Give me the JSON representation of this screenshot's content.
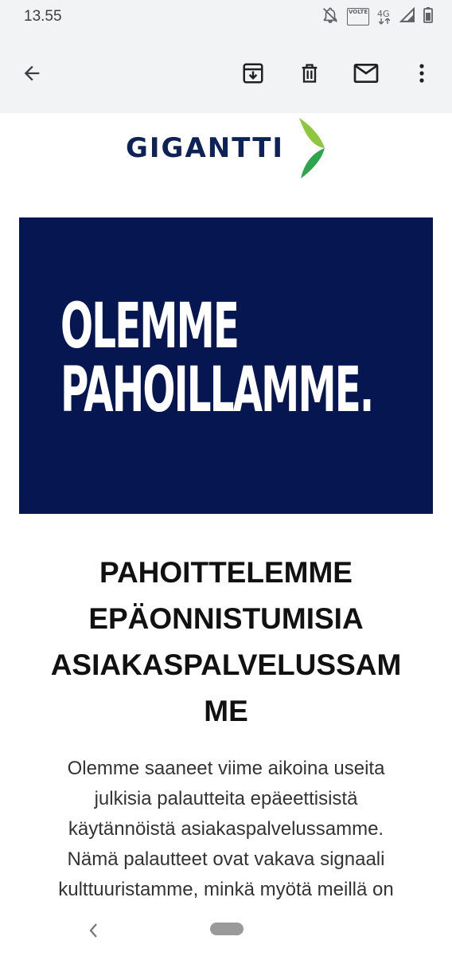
{
  "status_bar": {
    "time": "13.55",
    "icons": [
      "notifications-off-icon",
      "volte-icon",
      "4g-icon",
      "signal-icon",
      "battery-icon"
    ],
    "volte_label": "VOLTE",
    "network_label": "4G"
  },
  "toolbar": {
    "back_icon": "arrow-back-icon",
    "archive_icon": "archive-icon",
    "delete_icon": "delete-icon",
    "mark_unread_icon": "mail-icon",
    "more_icon": "more-vert-icon"
  },
  "email": {
    "brand": {
      "name": "GIGANTTI",
      "colors": {
        "navy": "#0d2257",
        "green_light": "#8dc63f",
        "green_dark": "#2ea44f"
      }
    },
    "hero": {
      "line1": "OLEMME",
      "line2": "PAHOILLAMME.",
      "background": "#051650"
    },
    "heading_lines": [
      "PAHOITTELEMME",
      "EPÄONNISTUMISIA",
      "ASIAKASPALVELUSSAM",
      "ME"
    ],
    "body_lines": [
      "Olemme saaneet viime aikoina useita",
      "julkisia palautteita epäeettisistä",
      "käytännöistä asiakaspalvelussamme.",
      "Nämä palautteet ovat vakava signaali",
      "kulttuuristamme, minkä myötä meillä on"
    ]
  },
  "nav_bar": {
    "back_icon": "nav-back-icon",
    "home_icon": "home-pill-icon"
  }
}
